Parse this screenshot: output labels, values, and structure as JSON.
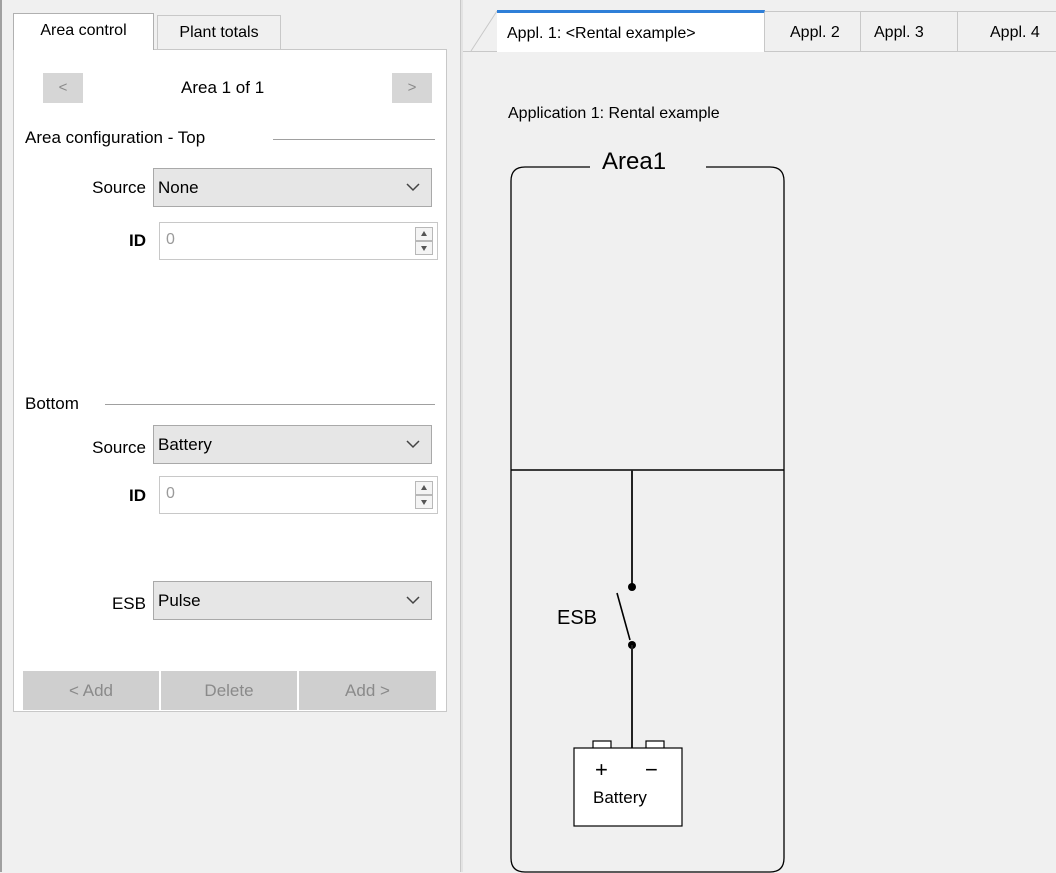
{
  "left_tabs": [
    "Area control",
    "Plant totals"
  ],
  "area_nav": {
    "prev": "<",
    "label": "Area 1 of 1",
    "next": ">"
  },
  "top_section": {
    "heading": "Area configuration - Top",
    "source_label": "Source",
    "source_value": "None",
    "id_label": "ID",
    "id_value": "0"
  },
  "bottom_section": {
    "heading": "Bottom",
    "source_label": "Source",
    "source_value": "Battery",
    "id_label": "ID",
    "id_value": "0",
    "esb_label": "ESB",
    "esb_value": "Pulse"
  },
  "buttons": {
    "add_left": "< Add",
    "delete": "Delete",
    "add_right": "Add >"
  },
  "app_tabs": [
    "Appl. 1: <Rental example>",
    "Appl. 2",
    "Appl. 3",
    "Appl. 4"
  ],
  "diagram": {
    "app_title": "Application 1: Rental example",
    "area_name": "Area1",
    "switch_label": "ESB",
    "battery_plus": "+",
    "battery_minus": "−",
    "battery_label": "Battery"
  },
  "colors": {
    "active_tab_accent": "#2f7fd8",
    "pane_bg": "#ffffff",
    "window_bg": "#f0f0f0"
  }
}
